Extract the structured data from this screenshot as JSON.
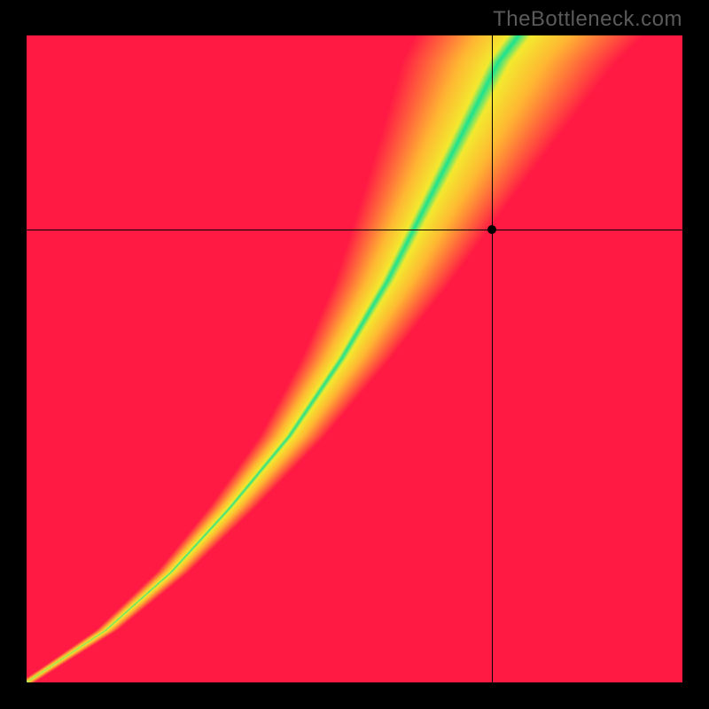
{
  "watermark": "TheBottleneck.com",
  "chart_data": {
    "type": "heatmap",
    "title": "",
    "xlabel": "",
    "ylabel": "",
    "xlim": [
      0,
      100
    ],
    "ylim": [
      0,
      100
    ],
    "marker": {
      "x": 71,
      "y": 70
    },
    "crosshair": {
      "x": 71,
      "y": 70
    },
    "ridge_points": [
      {
        "x": 0,
        "y": 0
      },
      {
        "x": 12,
        "y": 8
      },
      {
        "x": 22,
        "y": 17
      },
      {
        "x": 31,
        "y": 27
      },
      {
        "x": 40,
        "y": 38
      },
      {
        "x": 48,
        "y": 50
      },
      {
        "x": 55,
        "y": 62
      },
      {
        "x": 60,
        "y": 72
      },
      {
        "x": 64,
        "y": 80
      },
      {
        "x": 68,
        "y": 88
      },
      {
        "x": 72,
        "y": 96
      },
      {
        "x": 75,
        "y": 100
      }
    ],
    "ridge_width_scale": 0.11,
    "colors": {
      "ridge": "#19e391",
      "near": "#f4ea2f",
      "mid": "#ffb733",
      "far": "#ff1a44"
    }
  }
}
